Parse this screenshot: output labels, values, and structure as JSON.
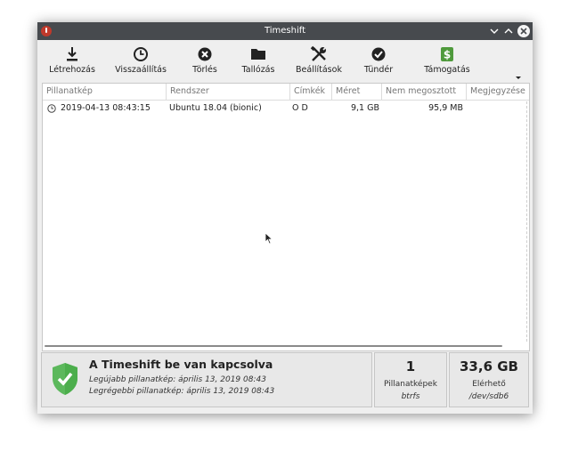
{
  "window": {
    "title": "Timeshift",
    "controls": {
      "minimize": "⌄",
      "maximize": "⌃",
      "close": "×"
    }
  },
  "toolbar": {
    "items": [
      {
        "label": "Létrehozás",
        "icon": "download-icon"
      },
      {
        "label": "Visszaállítás",
        "icon": "clock-icon"
      },
      {
        "label": "Törlés",
        "icon": "delete-icon"
      },
      {
        "label": "Tallózás",
        "icon": "folder-icon"
      },
      {
        "label": "Beállítások",
        "icon": "tools-icon"
      },
      {
        "label": "Tündér",
        "icon": "wizard-check-icon"
      },
      {
        "label": "Támogatás",
        "icon": "dollar-icon"
      }
    ],
    "menu_icon": "chevron-down-icon"
  },
  "table": {
    "headers": [
      "Pillanatkép",
      "Rendszer",
      "Címkék",
      "Méret",
      "Nem megosztott",
      "Megjegyzése"
    ],
    "rows": [
      {
        "snapshot": "2019-04-13 08:43:15",
        "system": "Ubuntu 18.04 (bionic)",
        "tags": "O D",
        "size": "9,1 GB",
        "unshared": "95,9 MB",
        "comment": ""
      }
    ]
  },
  "status": {
    "title": "A Timeshift be van kapcsolva",
    "latest": "Legújabb pillanatkép: április 13, 2019 08:43",
    "oldest": "Legrégebbi pillanatkép: április 13, 2019 08:43",
    "shield_color": "#5cb85c"
  },
  "snapshots_box": {
    "count": "1",
    "label": "Pillanatképek",
    "fs": "btrfs"
  },
  "space_box": {
    "value": "33,6 GB",
    "label": "Elérhető",
    "device": "/dev/sdb6"
  }
}
